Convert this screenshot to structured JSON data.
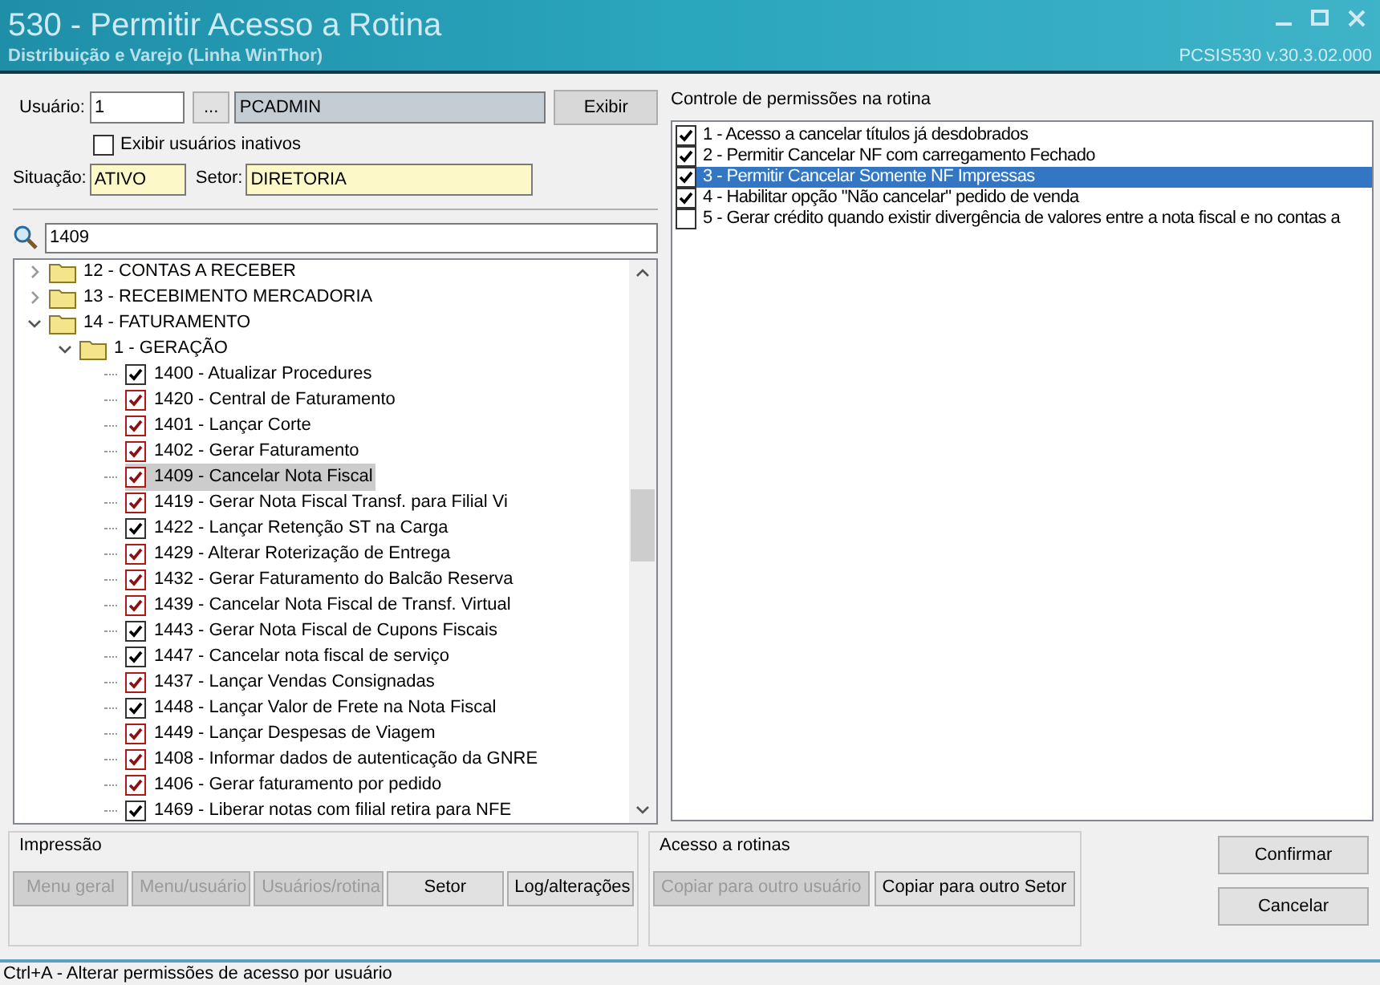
{
  "window": {
    "title": "530 - Permitir Acesso a Rotina",
    "subtitle": "Distribuição e Varejo (Linha WinThor)",
    "version": "PCSIS530  v.30.3.02.000"
  },
  "user": {
    "label": "Usuário:",
    "code": "1",
    "lookup": "...",
    "name": "PCADMIN",
    "button": "Exibir"
  },
  "show_inactive": {
    "label": "Exibir usuários inativos",
    "checked": false
  },
  "situation": {
    "label": "Situação:",
    "value": "ATIVO"
  },
  "sector": {
    "label": "Setor:",
    "value": "DIRETORIA"
  },
  "search": {
    "value": "1409"
  },
  "tree": [
    {
      "kind": "folder",
      "label": "12 - CONTAS A RECEBER",
      "expanded": false
    },
    {
      "kind": "folder",
      "label": "13 - RECEBIMENTO MERCADORIA",
      "expanded": false
    },
    {
      "kind": "folder",
      "label": "14 - FATURAMENTO",
      "expanded": true,
      "children": [
        {
          "kind": "folder",
          "label": "1 - GERAÇÃO",
          "expanded": true,
          "children": [
            {
              "kind": "routine",
              "label": "1400 - Atualizar Procedures",
              "checked": true,
              "modified": false,
              "selected": false
            },
            {
              "kind": "routine",
              "label": "1420 - Central de Faturamento",
              "checked": true,
              "modified": true,
              "selected": false
            },
            {
              "kind": "routine",
              "label": "1401 - Lançar Corte",
              "checked": true,
              "modified": true,
              "selected": false
            },
            {
              "kind": "routine",
              "label": "1402 - Gerar Faturamento",
              "checked": true,
              "modified": true,
              "selected": false
            },
            {
              "kind": "routine",
              "label": "1409 - Cancelar Nota Fiscal",
              "checked": true,
              "modified": true,
              "selected": true
            },
            {
              "kind": "routine",
              "label": "1419 - Gerar Nota Fiscal Transf. para Filial Vi",
              "checked": true,
              "modified": true,
              "selected": false
            },
            {
              "kind": "routine",
              "label": "1422 - Lançar Retenção ST na Carga",
              "checked": true,
              "modified": false,
              "selected": false
            },
            {
              "kind": "routine",
              "label": "1429 - Alterar Roterização de Entrega",
              "checked": true,
              "modified": true,
              "selected": false
            },
            {
              "kind": "routine",
              "label": "1432 - Gerar Faturamento do Balcão Reserva",
              "checked": true,
              "modified": true,
              "selected": false
            },
            {
              "kind": "routine",
              "label": "1439 - Cancelar Nota Fiscal de Transf. Virtual",
              "checked": true,
              "modified": true,
              "selected": false
            },
            {
              "kind": "routine",
              "label": "1443 - Gerar Nota Fiscal de Cupons Fiscais",
              "checked": true,
              "modified": false,
              "selected": false
            },
            {
              "kind": "routine",
              "label": "1447 - Cancelar nota fiscal de serviço",
              "checked": true,
              "modified": false,
              "selected": false
            },
            {
              "kind": "routine",
              "label": "1437 - Lançar Vendas Consignadas",
              "checked": true,
              "modified": true,
              "selected": false
            },
            {
              "kind": "routine",
              "label": "1448 - Lançar Valor de Frete na Nota Fiscal",
              "checked": true,
              "modified": false,
              "selected": false
            },
            {
              "kind": "routine",
              "label": "1449 - Lançar Despesas de Viagem",
              "checked": true,
              "modified": true,
              "selected": false
            },
            {
              "kind": "routine",
              "label": "1408 - Informar dados de autenticação da GNRE",
              "checked": true,
              "modified": true,
              "selected": false
            },
            {
              "kind": "routine",
              "label": "1406 - Gerar faturamento por pedido",
              "checked": true,
              "modified": true,
              "selected": false
            },
            {
              "kind": "routine",
              "label": "1469 - Liberar notas com filial retira para NFE",
              "checked": true,
              "modified": false,
              "selected": false
            }
          ]
        }
      ]
    }
  ],
  "permissions": {
    "title": "Controle de permissões na rotina",
    "items": [
      {
        "label": "1 - Acesso a cancelar títulos já desdobrados",
        "checked": true,
        "selected": false
      },
      {
        "label": "2 - Permitir Cancelar NF com carregamento Fechado",
        "checked": true,
        "selected": false
      },
      {
        "label": "3 - Permitir Cancelar Somente NF Impressas",
        "checked": true,
        "selected": true
      },
      {
        "label": "4 - Habilitar opção \"Não cancelar\" pedido de venda",
        "checked": true,
        "selected": false
      },
      {
        "label": "5 - Gerar crédito quando existir divergência de valores entre a nota fiscal e no contas a",
        "checked": false,
        "selected": false
      }
    ]
  },
  "print_group": {
    "title": "Impressão",
    "buttons": [
      {
        "label": "Menu geral",
        "disabled": true
      },
      {
        "label": "Menu/usuário",
        "disabled": true
      },
      {
        "label": "Usuários/rotina",
        "disabled": true
      },
      {
        "label": "Setor",
        "disabled": false
      },
      {
        "label": "Log/alterações",
        "disabled": false
      }
    ]
  },
  "access_group": {
    "title": "Acesso a rotinas",
    "buttons": [
      {
        "label": "Copiar para outro usuário",
        "disabled": true
      },
      {
        "label": "Copiar para outro Setor",
        "disabled": false
      }
    ]
  },
  "actions": [
    "Confirmar",
    "Cancelar"
  ],
  "status_bar": "Ctrl+A - Alterar permissões de acesso por usuário"
}
